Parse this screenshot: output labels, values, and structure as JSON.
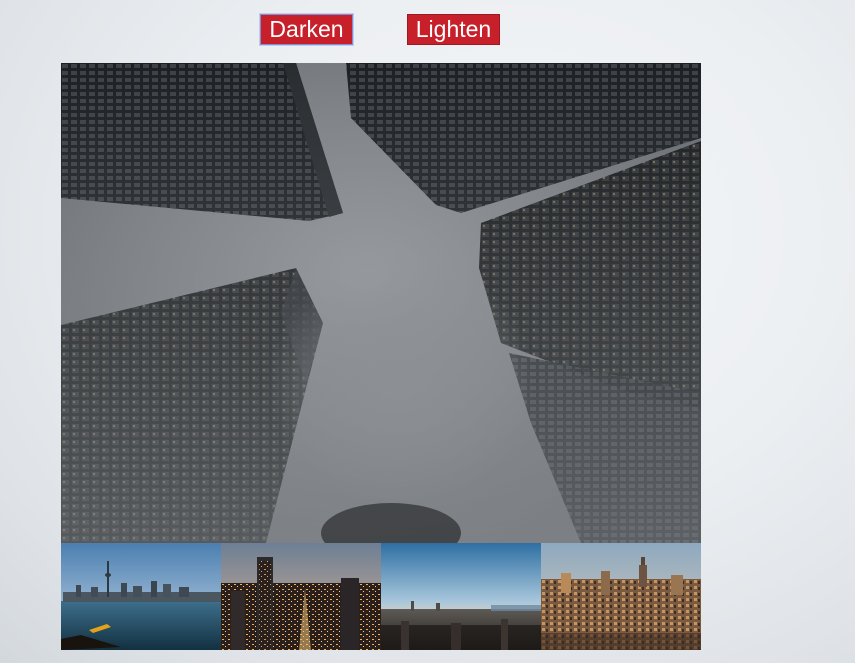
{
  "controls": {
    "darken_label": "Darken",
    "lighten_label": "Lighten"
  },
  "gallery": {
    "main_image": "looking-up-foggy-skyscrapers",
    "thumbnails": [
      "toronto-waterfront-kayak",
      "city-lights-dusk",
      "city-aerial-sunset",
      "manhattan-aerial"
    ]
  },
  "colors": {
    "button_bg": "#c8202a",
    "button_text": "#ffffff",
    "focus_border": "#7f8fd6"
  }
}
